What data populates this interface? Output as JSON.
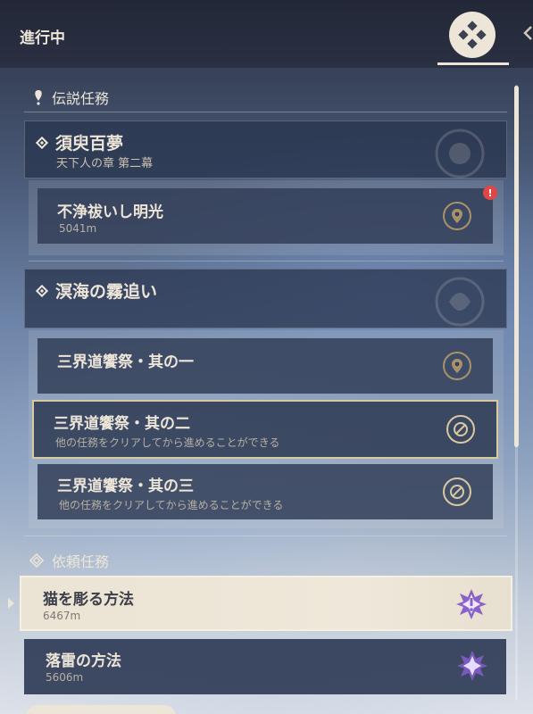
{
  "header": {
    "title": "進行中",
    "toggle_icon": "quest-diamond-icon",
    "collapse_icon": "chevron-left-icon"
  },
  "sections": {
    "legend": {
      "label": "伝説任務",
      "icon": "legend-exclamation-icon"
    },
    "commission": {
      "label": "依頼任務",
      "icon": "commission-diamond-icon"
    }
  },
  "chapters": [
    {
      "title": "須臾百夢",
      "subtitle": "天下人の章 第二幕",
      "icon": "chapter-diamond-icon",
      "emblem": "emblem-icon"
    },
    {
      "title": "溟海の霧追い",
      "subtitle": "",
      "icon": "chapter-diamond-icon",
      "emblem": "emblem-icon"
    }
  ],
  "quests": [
    {
      "name": "不浄祓いし明光",
      "sub": "5041m",
      "icon": "location-pin-icon",
      "alert": "!"
    },
    {
      "name": "三界道饗祭・其の一",
      "sub": "",
      "icon": "location-pin-icon"
    },
    {
      "name": "三界道饗祭・其の二",
      "sub": "他の任務をクリアしてから進めることができる",
      "icon": "blocked-icon"
    },
    {
      "name": "三界道饗祭・其の三",
      "sub": "他の任務をクリアしてから進めることができる",
      "icon": "blocked-icon"
    }
  ],
  "commissions": [
    {
      "name": "猫を彫る方法",
      "sub": "6467m",
      "icon": "commission-quest-icon"
    },
    {
      "name": "落雷の方法",
      "sub": "5606m",
      "icon": "commission-quest-icon"
    }
  ],
  "colors": {
    "accent": "#ece5d8",
    "gold": "#a7926a",
    "alert": "#e04848",
    "commission_icon": "#8a63c8"
  }
}
